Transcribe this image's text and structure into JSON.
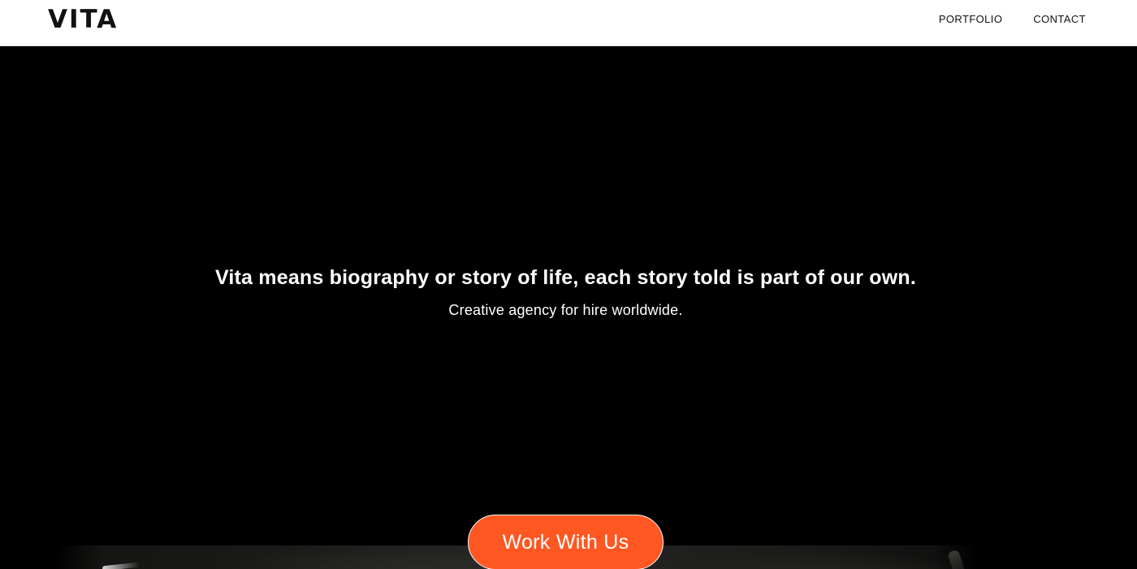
{
  "header": {
    "brand": "VITA",
    "nav": [
      {
        "label": "PORTFOLIO"
      },
      {
        "label": "CONTACT"
      }
    ]
  },
  "hero": {
    "headline": "Vita means biography or story of life, each story told is part of our own.",
    "subline": "Creative agency for hire worldwide.",
    "cta_label": "Work With Us"
  },
  "colors": {
    "header_bg": "#ffffff",
    "hero_bg": "#000000",
    "accent": "#ff5722",
    "text_light": "#ffffff",
    "text_dark": "#111111"
  }
}
